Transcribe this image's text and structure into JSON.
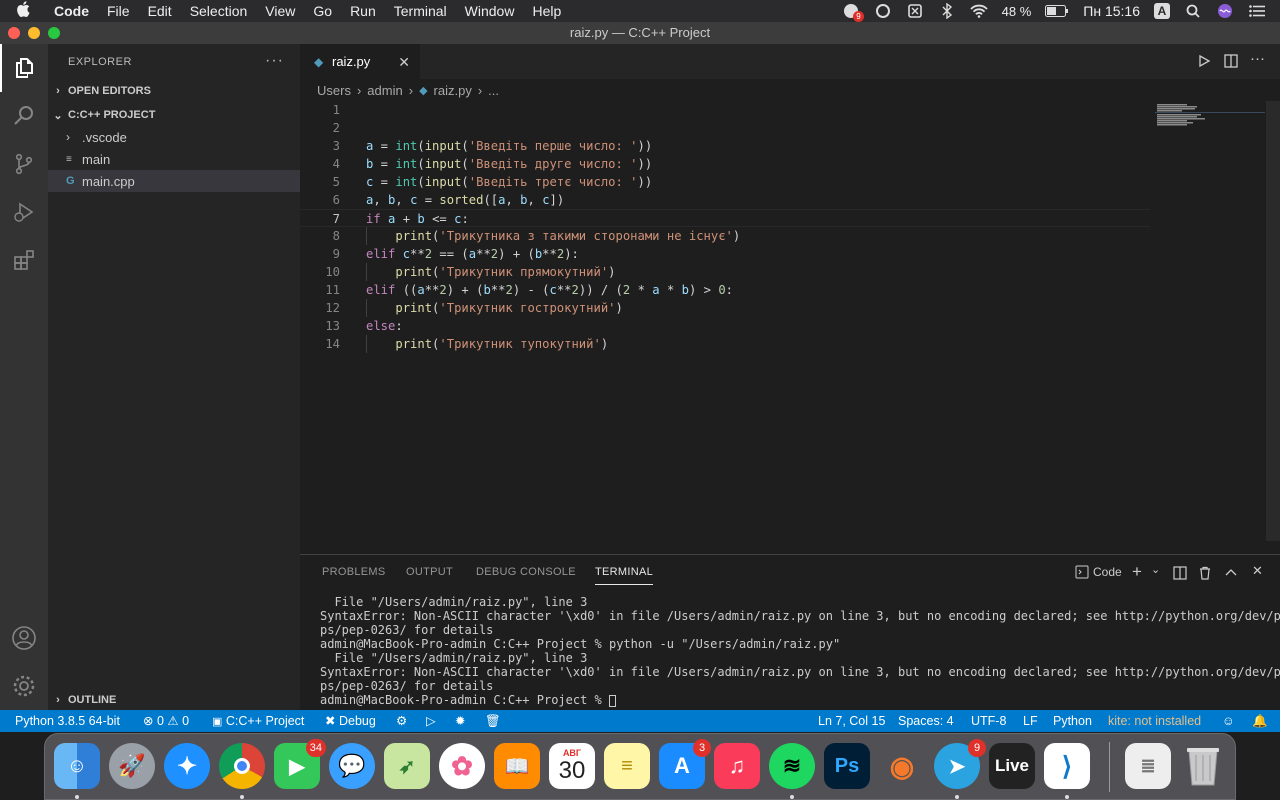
{
  "menubar": {
    "app_name": "Code",
    "items": [
      "File",
      "Edit",
      "Selection",
      "View",
      "Go",
      "Run",
      "Terminal",
      "Window",
      "Help"
    ],
    "battery": "48 %",
    "clock": "Пн 15:16",
    "input_source": "A",
    "notification_count": "9"
  },
  "window": {
    "title": "raiz.py — C:C++ Project"
  },
  "sidebar": {
    "header": "EXPLORER",
    "open_editors": "OPEN EDITORS",
    "project": "C:C++ PROJECT",
    "files": [
      ".vscode",
      "main",
      "main.cpp"
    ],
    "outline": "OUTLINE"
  },
  "editor": {
    "tab_label": "raiz.py",
    "breadcrumb": [
      "Users",
      "admin",
      "raiz.py",
      "..."
    ],
    "line_numbers": [
      "1",
      "2",
      "3",
      "4",
      "5",
      "6",
      "7",
      "8",
      "9",
      "10",
      "11",
      "12",
      "13",
      "14"
    ],
    "code": {
      "l3_prompt": "'Введіть перше число: '",
      "l4_prompt": "'Введіть друге число: '",
      "l5_prompt": "'Введіть третє число: '",
      "l8_msg": "'Трикутника з такими сторонами не існує'",
      "l10_msg": "'Трикутник прямокутний'",
      "l12_msg": "'Трикутник гострокутний'",
      "l14_msg": "'Трикутник тупокутний'"
    }
  },
  "panel": {
    "tabs": [
      "PROBLEMS",
      "OUTPUT",
      "DEBUG CONSOLE",
      "TERMINAL"
    ],
    "active_tab": "TERMINAL",
    "terminal_name": "Code",
    "terminal_lines": [
      "  File \"/Users/admin/raiz.py\", line 3",
      "SyntaxError: Non-ASCII character '\\xd0' in file /Users/admin/raiz.py on line 3, but no encoding declared; see http://python.org/dev/pe",
      "ps/pep-0263/ for details",
      "admin@MacBook-Pro-admin C:C++ Project % python -u \"/Users/admin/raiz.py\"",
      "  File \"/Users/admin/raiz.py\", line 3",
      "SyntaxError: Non-ASCII character '\\xd0' in file /Users/admin/raiz.py on line 3, but no encoding declared; see http://python.org/dev/pe",
      "ps/pep-0263/ for details",
      "admin@MacBook-Pro-admin C:C++ Project % "
    ]
  },
  "statusbar": {
    "interpreter": "Python 3.8.5 64-bit",
    "errors": "0",
    "warnings": "0",
    "folder": "C:C++ Project",
    "debug": "Debug",
    "position": "Ln 7, Col 15",
    "spaces": "Spaces: 4",
    "encoding": "UTF-8",
    "eol": "LF",
    "language": "Python",
    "kite": "kite: not installed"
  },
  "dock": {
    "facetime_badge": "34",
    "calendar_month": "АВГ",
    "calendar_day": "30",
    "appstore_badge": "3",
    "telegram_badge": "9",
    "live_label": "Live",
    "photoshop_label": "Ps"
  },
  "colors": {
    "accent": "#007acc",
    "keyword": "#c586c0",
    "string": "#ce9178",
    "kite_warning": "#e2c08d"
  }
}
